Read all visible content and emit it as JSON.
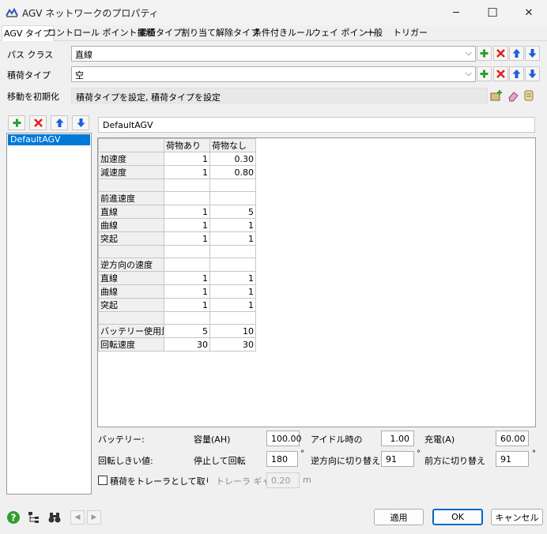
{
  "window": {
    "title": "AGV ネットワークのプロパティ",
    "minimize_glyph": "─",
    "maximize_glyph": "☐",
    "close_glyph": "✕"
  },
  "tabs": [
    {
      "label": "AGV タイプ",
      "active": true
    },
    {
      "label": "コントロール ポイント接続"
    },
    {
      "label": "累積タイプ"
    },
    {
      "label": "割り当て解除タイプ"
    },
    {
      "label": "条件付きルール"
    },
    {
      "label": "ウェイ ポイント"
    },
    {
      "label": "一般"
    },
    {
      "label": "トリガー"
    }
  ],
  "path_class": {
    "label": "パス クラス",
    "value": "直線"
  },
  "load_type": {
    "label": "積荷タイプ",
    "value": "空"
  },
  "travel_init": {
    "label": "移動を初期化",
    "value": "積荷タイプを設定, 積荷タイプを設定"
  },
  "agv_list": {
    "items": [
      "DefaultAGV"
    ]
  },
  "agv_name": "DefaultAGV",
  "grid": {
    "columns": [
      "荷物あり",
      "荷物なし"
    ],
    "rows": [
      {
        "label": "加速度",
        "v1": "1",
        "v2": "0.30"
      },
      {
        "label": "減速度",
        "v1": "1",
        "v2": "0.80"
      },
      {
        "label": "",
        "v1": "",
        "v2": ""
      },
      {
        "label": "前進速度",
        "v1": "",
        "v2": ""
      },
      {
        "label": "直線",
        "v1": "1",
        "v2": "5"
      },
      {
        "label": "曲線",
        "v1": "1",
        "v2": "1"
      },
      {
        "label": "突起",
        "v1": "1",
        "v2": "1"
      },
      {
        "label": "",
        "v1": "",
        "v2": ""
      },
      {
        "label": "逆方向の速度",
        "v1": "",
        "v2": ""
      },
      {
        "label": "直線",
        "v1": "1",
        "v2": "1"
      },
      {
        "label": "曲線",
        "v1": "1",
        "v2": "1"
      },
      {
        "label": "突起",
        "v1": "1",
        "v2": "1"
      },
      {
        "label": "",
        "v1": "",
        "v2": ""
      },
      {
        "label": "バッテリー使用量(A",
        "v1": "5",
        "v2": "10"
      },
      {
        "label": "回転速度",
        "v1": "30",
        "v2": "30"
      }
    ]
  },
  "battery": {
    "label": "バッテリー:",
    "capacity_label": "容量(AH)",
    "capacity": "100.00",
    "idle_label": "アイドル時の",
    "idle": "1.00",
    "charge_label": "充電(A)",
    "charge": "60.00"
  },
  "rotation": {
    "label": "回転しきい値:",
    "stop_label": "停止して回転",
    "stop": "180",
    "reverse_label": "逆方向に切り替え",
    "reverse": "91",
    "forward_label": "前方に切り替え",
    "forward": "91",
    "degree": "°"
  },
  "trailer": {
    "checkbox_label": "積荷をトレーラとして取り付け",
    "gap_label": "トレーラ ギャッ",
    "gap": "0.20",
    "unit": "m"
  },
  "footer": {
    "apply": "適用",
    "ok": "OK",
    "cancel": "キャンセル",
    "prev": "◀",
    "next": "▶"
  },
  "colors": {
    "selection": "#0078d7",
    "add_green": "#2e9e2e",
    "delete_red": "#e02020",
    "arrow_blue": "#1f5fd6"
  }
}
